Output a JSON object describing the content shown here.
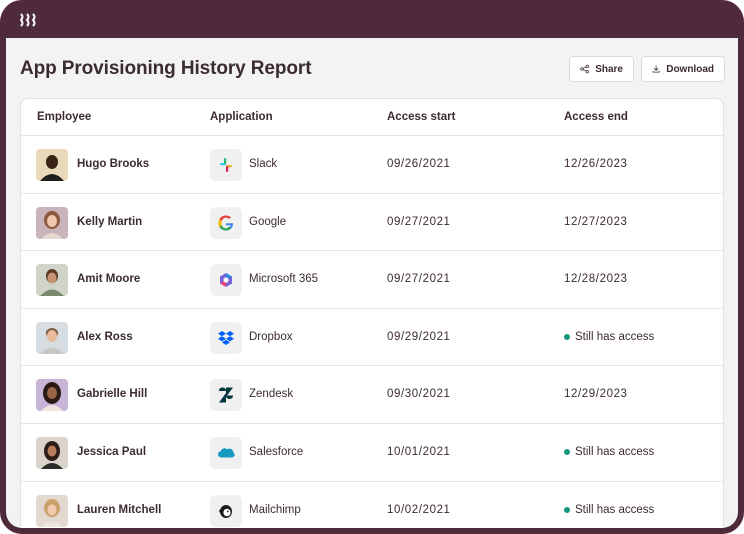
{
  "page_title": "App Provisioning History Report",
  "actions": {
    "share_label": "Share",
    "download_label": "Download"
  },
  "columns": [
    "Employee",
    "Application",
    "Access start",
    "Access end"
  ],
  "rows": [
    {
      "employee": "Hugo Brooks",
      "app": "Slack",
      "app_icon": "slack-icon",
      "start": "09/26/2021",
      "end": "12/26/2023"
    },
    {
      "employee": "Kelly Martin",
      "app": "Google",
      "app_icon": "google-icon",
      "start": "09/27/2021",
      "end": "12/27/2023"
    },
    {
      "employee": "Amit Moore",
      "app": "Microsoft 365",
      "app_icon": "microsoft-365-icon",
      "start": "09/27/2021",
      "end": "12/28/2023"
    },
    {
      "employee": "Alex Ross",
      "app": "Dropbox",
      "app_icon": "dropbox-icon",
      "start": "09/29/2021",
      "end": "Still has access"
    },
    {
      "employee": "Gabrielle Hill",
      "app": "Zendesk",
      "app_icon": "zendesk-icon",
      "start": "09/30/2021",
      "end": "12/29/2023"
    },
    {
      "employee": "Jessica Paul",
      "app": "Salesforce",
      "app_icon": "salesforce-icon",
      "start": "10/01/2021",
      "end": "Still has access"
    },
    {
      "employee": "Lauren Mitchell",
      "app": "Mailchimp",
      "app_icon": "mailchimp-icon",
      "start": "10/02/2021",
      "end": "Still has access"
    }
  ],
  "colors": {
    "frame": "#4e2a3a",
    "background": "#f4f3f3",
    "active_dot": "#15967f"
  }
}
